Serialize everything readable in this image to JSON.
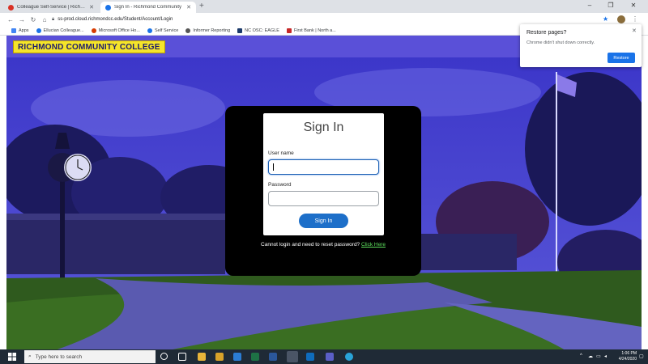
{
  "browser": {
    "tabs": [
      {
        "label": "Colleague Self-Service | Richmon",
        "favicon_color": "#d93025"
      },
      {
        "label": "Sign In - Richmond Community",
        "favicon_color": "#1a73e8"
      }
    ],
    "url": "ss-prod.cloud.richmondcc.edu/Student/Account/Login",
    "bookmarks": [
      {
        "label": "Apps",
        "icon_color": "#4285f4"
      },
      {
        "label": "Ellucian Colleague...",
        "icon_color": "#1a73e8"
      },
      {
        "label": "Microsoft Office Ho...",
        "icon_color": "#d83b01"
      },
      {
        "label": "Self Service",
        "icon_color": "#1a73e8"
      },
      {
        "label": "Informer Reporting",
        "icon_color": "#555555"
      },
      {
        "label": "NC OSC: EAGLE",
        "icon_color": "#1b3a6b"
      },
      {
        "label": "First Bank | North a...",
        "icon_color": "#c62828"
      }
    ],
    "window_controls": [
      "–",
      "❐",
      "✕"
    ]
  },
  "site": {
    "logo_text": "RICHMOND COMMUNITY COLLEGE",
    "header_color": "#5a50d8"
  },
  "signin": {
    "title": "Sign In",
    "username_label": "User name",
    "username_value": "",
    "password_label": "Password",
    "password_value": "",
    "button_label": "Sign In",
    "reset_text": "Cannot login and need to reset password? ",
    "reset_link": "Click Here"
  },
  "restore_popup": {
    "title": "Restore pages?",
    "message": "Chrome didn't shut down correctly.",
    "button_label": "Restore"
  },
  "taskbar": {
    "search_placeholder": "Type here to search",
    "time": "1:06 PM",
    "date": "4/24/2020"
  }
}
